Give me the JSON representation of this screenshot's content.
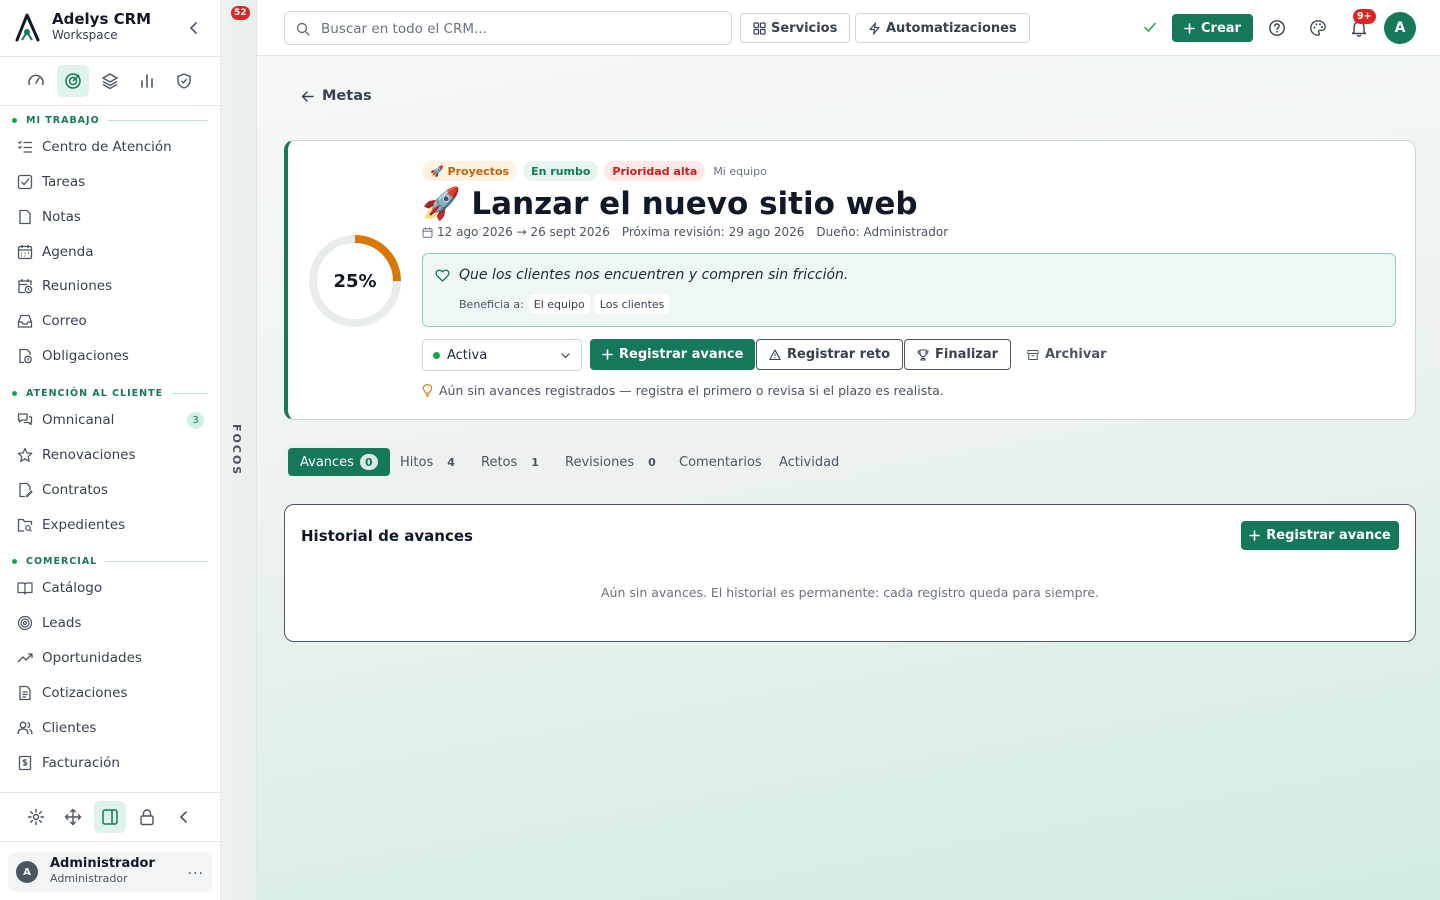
{
  "brand": {
    "name": "Adelys CRM",
    "subtitle": "Workspace"
  },
  "modules": [
    "gauge-icon",
    "goal-icon",
    "layers-icon",
    "bar-chart-icon",
    "shield-icon"
  ],
  "sidebar": {
    "sections": [
      {
        "label": "MI TRABAJO",
        "items": [
          {
            "label": "Centro de Atención",
            "icon": "checklist-icon"
          },
          {
            "label": "Tareas",
            "icon": "square-check-icon"
          },
          {
            "label": "Notas",
            "icon": "file-icon"
          },
          {
            "label": "Agenda",
            "icon": "calendar-icon"
          },
          {
            "label": "Reuniones",
            "icon": "calendar-clock-icon"
          },
          {
            "label": "Correo",
            "icon": "inbox-icon"
          },
          {
            "label": "Obligaciones",
            "icon": "file-clock-icon"
          }
        ]
      },
      {
        "label": "ATENCIÓN AL CLIENTE",
        "items": [
          {
            "label": "Omnicanal",
            "icon": "chats-icon",
            "badge": "3"
          },
          {
            "label": "Renovaciones",
            "icon": "star-icon"
          },
          {
            "label": "Contratos",
            "icon": "file-signature-icon"
          },
          {
            "label": "Expedientes",
            "icon": "folder-search-icon"
          }
        ]
      },
      {
        "label": "COMERCIAL",
        "items": [
          {
            "label": "Catálogo",
            "icon": "book-open-icon"
          },
          {
            "label": "Leads",
            "icon": "target-icon"
          },
          {
            "label": "Oportunidades",
            "icon": "trending-up-icon"
          },
          {
            "label": "Cotizaciones",
            "icon": "file-text-icon"
          },
          {
            "label": "Clientes",
            "icon": "users-icon"
          },
          {
            "label": "Facturación",
            "icon": "receipt-icon"
          }
        ]
      }
    ]
  },
  "user": {
    "initial": "A",
    "name": "Administrador",
    "role": "Administrador",
    "more": "..."
  },
  "focos": {
    "label": "FOCOS",
    "badge": "52"
  },
  "topbar": {
    "search_placeholder": "Buscar en todo el CRM...",
    "servicios": "Servicios",
    "automatizaciones": "Automatizaciones",
    "crear": "Crear",
    "notif_badge": "9+",
    "avatar": "A"
  },
  "back": "Metas",
  "goal": {
    "progress_label": "25%",
    "progress": 0.25,
    "tags": {
      "project": "🚀 Proyectos",
      "status": "En rumbo",
      "priority": "Prioridad alta",
      "team": "Mi equipo"
    },
    "title": "🚀 Lanzar el nuevo sitio web",
    "dates": "12 ago 2026 → 26 sept 2026",
    "next_review": "Próxima revisión: 29 ago 2026",
    "owner": "Dueño: Administrador",
    "purpose": "Que los clientes nos encuentren y compren sin fricción.",
    "benefits_label": "Beneficia a:",
    "beneficiaries": [
      "El equipo",
      "Los clientes"
    ],
    "status": "Activa",
    "actions": {
      "register": "Registrar avance",
      "challenge": "Registrar reto",
      "finish": "Finalizar",
      "archive": "Archivar"
    },
    "hint": "Aún sin avances registrados — registra el primero o revisa si el plazo es realista."
  },
  "tabs": [
    {
      "label": "Avances",
      "count": "0"
    },
    {
      "label": "Hitos",
      "count": "4"
    },
    {
      "label": "Retos",
      "count": "1"
    },
    {
      "label": "Revisiones",
      "count": "0"
    },
    {
      "label": "Comentarios",
      "count": ""
    },
    {
      "label": "Actividad",
      "count": ""
    }
  ],
  "history": {
    "title": "Historial de avances",
    "button": "Registrar avance",
    "empty": "Aún sin avances. El historial es permanente: cada registro queda para siempre."
  },
  "colors": {
    "primary": "#15785a",
    "accent_orange": "#d97706",
    "danger": "#dc2626"
  }
}
